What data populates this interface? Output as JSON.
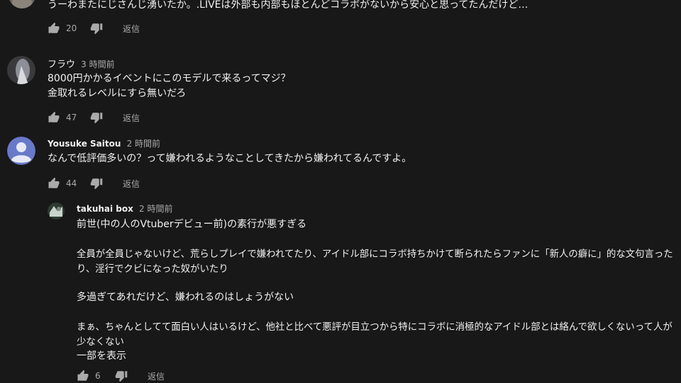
{
  "comments": [
    {
      "text": "うーわまたにじさんじ湧いたか。.LIVEは外部も内部もほとんどコラボがないから安心と思ってたんだけど…",
      "likes": "20",
      "reply_label": "返信"
    },
    {
      "author": "フラウ",
      "time": "3 時間前",
      "text": "8000円かかるイベントにこのモデルで来るってマジ？\n金取れるレベルにすら無いだろ",
      "likes": "47",
      "reply_label": "返信"
    },
    {
      "author": "Yousuke Saitou",
      "time": "2 時間前",
      "text": "なんで低評価多いの？って嫌われるようなことしてきたから嫌われてるんですよ。",
      "likes": "44",
      "reply_label": "返信"
    }
  ],
  "reply": {
    "author": "takuhai box",
    "time": "2 時間前",
    "paragraphs": [
      "前世(中の人のVtuberデビュー前)の素行が悪すぎる",
      "全員が全員じゃないけど、荒らしプレイで嫌われてたり、アイドル部にコラボ持ちかけて断られたらファンに「新人の癖に」的な文句言ったり、淫行でクビになった奴がいたり",
      "多過ぎてあれだけど、嫌われるのはしょうがない",
      "まぁ、ちゃんとしてて面白い人はいるけど、他社と比べて悪評が目立つから特にコラボに消極的なアイドル部とは絡んで欲しくないって人が少なくない"
    ],
    "show_more": "一部を表示",
    "likes": "6",
    "reply_label": "返信"
  },
  "colors": {
    "background": "#181818",
    "text": "#f1f1f1",
    "secondary": "#aaaaaa",
    "avatar_default": "#6979c9"
  }
}
